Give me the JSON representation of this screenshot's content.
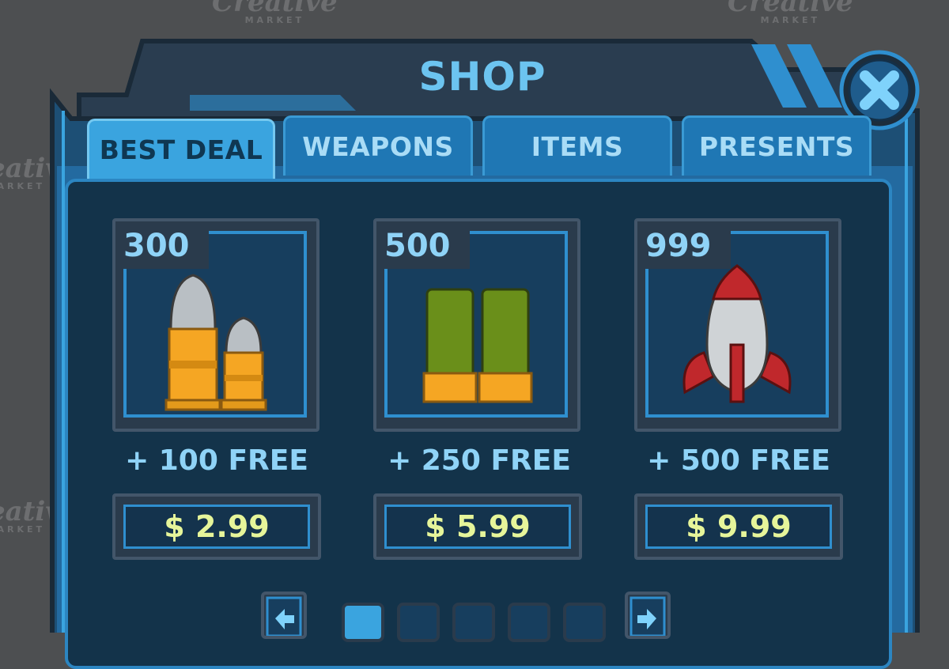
{
  "title": "SHOP",
  "watermark": {
    "brand": "Creative",
    "sub": "MARKET"
  },
  "tabs": [
    {
      "label": "BEST DEAL",
      "active": true
    },
    {
      "label": "WEAPONS",
      "active": false
    },
    {
      "label": "ITEMS",
      "active": false
    },
    {
      "label": "PRESENTS",
      "active": false
    }
  ],
  "items": [
    {
      "quantity": "300",
      "bonus": "+ 100 FREE",
      "price": "$ 2.99",
      "icon": "bullets-icon"
    },
    {
      "quantity": "500",
      "bonus": "+ 250 FREE",
      "price": "$ 5.99",
      "icon": "shotgun-shells-icon"
    },
    {
      "quantity": "999",
      "bonus": "+ 500 FREE",
      "price": "$ 9.99",
      "icon": "rocket-icon"
    }
  ],
  "pagination": {
    "pages": 5,
    "current": 1
  },
  "colors": {
    "accent": "#3aa4df",
    "price_text": "#e6f59a",
    "label_text": "#8fd3f7",
    "background": "#4d4f51"
  }
}
